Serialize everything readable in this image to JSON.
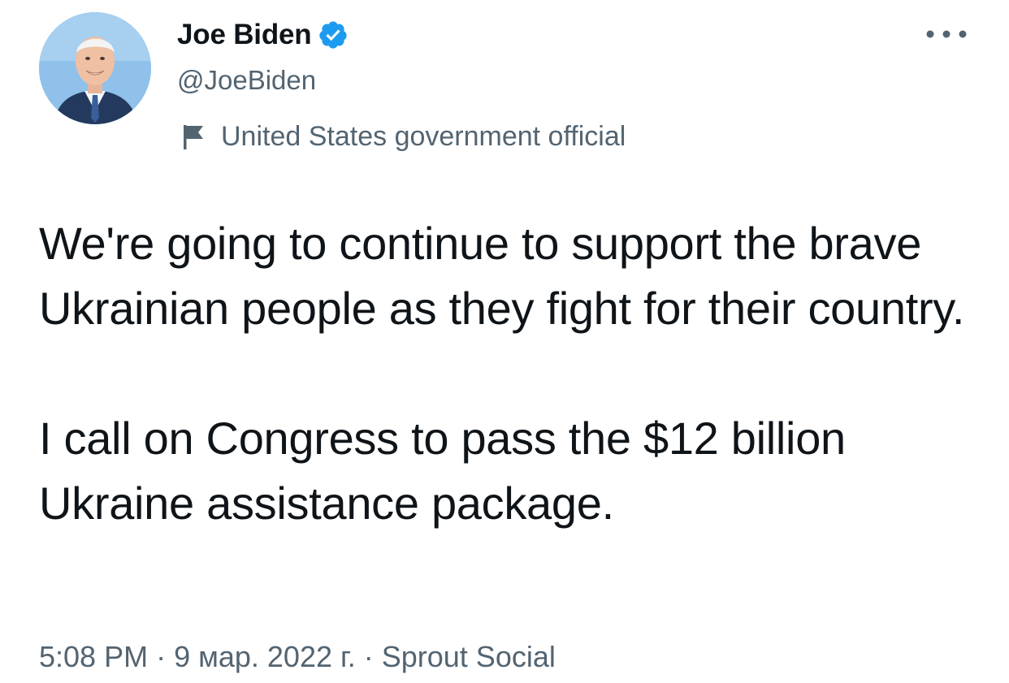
{
  "author": {
    "display_name": "Joe Biden",
    "handle": "@JoeBiden",
    "verified": true,
    "label": "United States government official",
    "avatar_icon": "joe-biden-avatar"
  },
  "tweet": {
    "paragraphs": [
      "We're going to continue to support the brave Ukrainian people as they fight for their country.",
      "I call on Congress to pass the $12 billion Ukraine assistance package."
    ]
  },
  "meta": {
    "time": "5:08 PM",
    "date": "9 мар. 2022 г.",
    "source": "Sprout Social",
    "separator": "·"
  },
  "icons": {
    "verified": "verified-badge-icon",
    "label": "flag-icon",
    "more": "more-options-icon"
  },
  "colors": {
    "text_primary": "#0f1419",
    "text_secondary": "#536471",
    "verified_blue": "#1d9bf0",
    "avatar_bg": "#8fc1ea"
  }
}
